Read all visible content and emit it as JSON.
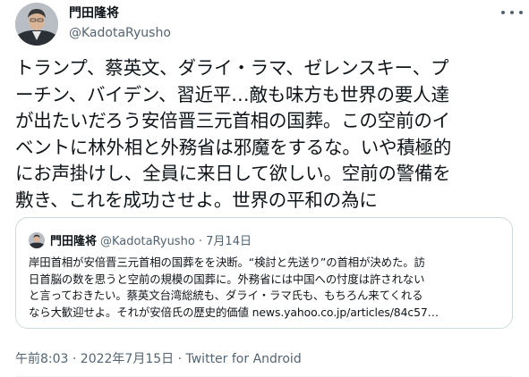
{
  "tweet": {
    "display_name": "門田隆将",
    "handle": "@KadotaRyusho",
    "text": "トランプ、蔡英文、ダライ・ラマ、ゼレンスキー、プ\nーチン、バイデン、習近平…敵も味方も世界の要人達\nが出たいだろう安倍晋三元首相の国葬。この空前のイ\nベントに林外相と外務省は邪魔をするな。いや積極的\nにお声掛けし、全員に来日して欲しい。空前の警備を\n敷き、これを成功させよ。世界の平和の為に",
    "timestamp": "午前8:03 · 2022年7月15日",
    "separator": " · ",
    "source": "Twitter for Android"
  },
  "quoted_tweet": {
    "display_name": "門田隆将",
    "meta": "@KadotaRyusho · 7月14日",
    "text": "岸田首相が安倍晋三元首相の国葬をを決断。“検討と先送り”の首相が決めた。訪\n日首脳の数を思うと空前の規模の国葬に。外務省には中国への忖度は許されない\nと言っておきたい。蔡英文台湾総統も、ダライ・ラマ氏も、もちろん来てくれる\nなら大歓迎せよ。それが安倍氏の歴史的価値 news.yahoo.co.jp/articles/84c57…"
  },
  "icons": {
    "avatar": "avatar-photo",
    "more": "more-icon"
  },
  "colors": {
    "text": "#0f1419",
    "secondary": "#536471",
    "border": "#cfd9de"
  }
}
